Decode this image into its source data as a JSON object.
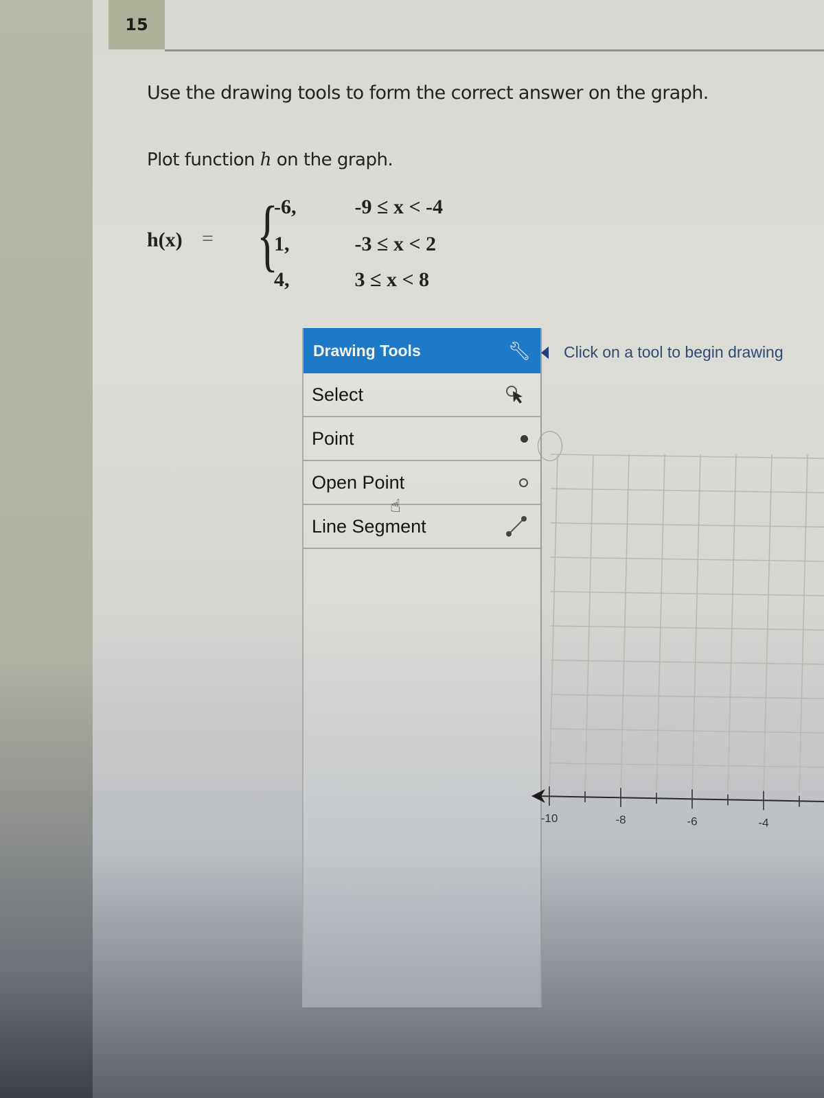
{
  "question": {
    "number": "15",
    "instruction": "Use the drawing tools to form the correct answer on the graph.",
    "prompt_before": "Plot function ",
    "prompt_var": "h",
    "prompt_after": " on the graph."
  },
  "function": {
    "lhs": "h(x)",
    "equals": "=",
    "pieces": [
      {
        "value": "-6,",
        "condition": "-9 ≤ x < -4"
      },
      {
        "value": "1,",
        "condition": "-3 ≤ x < 2"
      },
      {
        "value": "4,",
        "condition": "3 ≤ x < 8"
      }
    ]
  },
  "drawing_tools": {
    "title": "Drawing Tools",
    "header_icon": "wrench-icon",
    "items": [
      {
        "label": "Select",
        "icon": "select-pointer-icon"
      },
      {
        "label": "Point",
        "icon": "closed-point-icon"
      },
      {
        "label": "Open Point",
        "icon": "open-point-icon"
      },
      {
        "label": "Line Segment",
        "icon": "line-segment-icon"
      }
    ],
    "hint": "Click on a tool to begin drawing",
    "accent_color": "#1e7ac6"
  },
  "graph": {
    "x_tick_labels": [
      "-10",
      "-8",
      "-6",
      "-4"
    ],
    "x_visible_range": [
      -10,
      -3
    ],
    "grid": true
  }
}
